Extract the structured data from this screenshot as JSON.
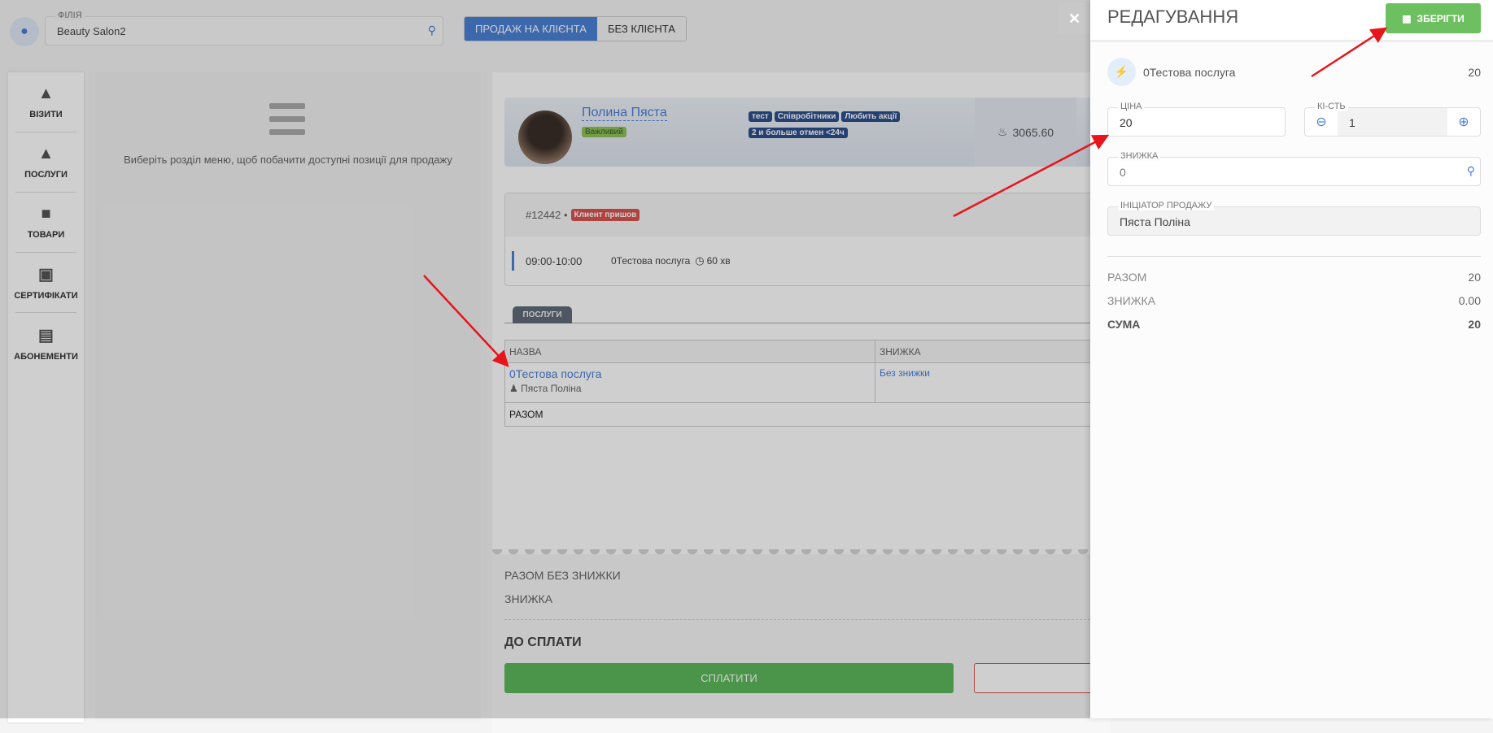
{
  "top": {
    "branch_label": "ФІЛІЯ",
    "branch_value": "Beauty Salon2",
    "mode_client": "ПРОДАЖ НА КЛІЄНТА",
    "mode_no_client": "БЕЗ КЛІЄНТА",
    "close": "✕"
  },
  "sidebar": {
    "items": [
      {
        "label": "ВІЗИТИ",
        "icon": "bell-icon"
      },
      {
        "label": "ПОСЛУГИ",
        "icon": "bell-icon"
      },
      {
        "label": "ТОВАРИ",
        "icon": "bag-icon"
      },
      {
        "label": "СЕРТИФІКАТИ",
        "icon": "gift-icon"
      },
      {
        "label": "АБОНЕМЕНТИ",
        "icon": "card-icon"
      }
    ]
  },
  "middle": {
    "hint": "Виберіть розділ меню, щоб побачити доступні позиції для продажу"
  },
  "client": {
    "name": "Полина Пяста",
    "badge": "Важливий",
    "tags": [
      "тест",
      "Співробітники",
      "Любить акції",
      "2 и больше отмен <24ч"
    ],
    "balance": "3065.60"
  },
  "visit": {
    "id": "#12442 •",
    "status": "Клиент пришов",
    "time": "09:00-10:00",
    "service": "0Тестова послуга",
    "duration": "60 хв"
  },
  "services": {
    "tab": "ПОСЛУГИ",
    "col_name": "НАЗВА",
    "col_discount": "ЗНИЖКА",
    "rows": [
      {
        "name": "0Тестова послуга",
        "master": "Пяста Поліна",
        "discount": "Без знижки"
      }
    ],
    "total_label": "РАЗОМ"
  },
  "summary": {
    "subtotal_label": "РАЗОМ БЕЗ ЗНИЖКИ",
    "discount_label": "ЗНИЖКА",
    "due_label": "ДО СПЛАТИ",
    "pay": "СПЛАТИТИ"
  },
  "edit": {
    "title": "РЕДАГУВАННЯ",
    "save": "ЗБЕРІГТИ",
    "service": "0Тестова послуга",
    "service_price": "20",
    "price_label": "ЦІНА",
    "price_value": "20",
    "qty_label": "КІ-СТЬ",
    "qty_value": "1",
    "discount_label": "ЗНИЖКА",
    "discount_value": "0",
    "initiator_label": "ІНІЦІАТОР ПРОДАЖУ",
    "initiator_value": "Пяста Поліна",
    "total_label": "РАЗОМ",
    "total_value": "20",
    "disc_label": "ЗНИЖКА",
    "disc_value": "0.00",
    "sum_label": "СУМА",
    "sum_value": "20"
  },
  "colors": {
    "primary": "#4a80d6",
    "success": "#5cb85c",
    "save": "#6cc05f",
    "danger": "#c9302c"
  }
}
